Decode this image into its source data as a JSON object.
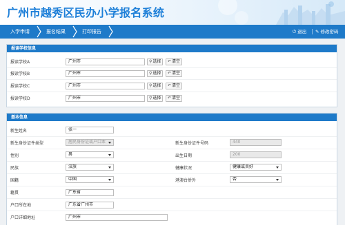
{
  "app": {
    "title": "广州市越秀区民办小学报名系统"
  },
  "nav": {
    "items": [
      {
        "label": "入学申请"
      },
      {
        "label": "报名结果"
      },
      {
        "label": "打印报告"
      }
    ],
    "logout_label": "退出",
    "change_password_label": "修改密码"
  },
  "school_section": {
    "title": "报读学校信息",
    "notice": "",
    "rows": [
      {
        "label": "报读学校A",
        "value": "广州市",
        "select_label": "选择",
        "clear_label": "清空"
      },
      {
        "label": "报读学校B",
        "value": "广州市",
        "select_label": "选择",
        "clear_label": "清空"
      },
      {
        "label": "报读学校C",
        "value": "广州市",
        "select_label": "选择",
        "clear_label": "清空"
      },
      {
        "label": "报读学校D",
        "value": "广州市",
        "select_label": "选择",
        "clear_label": "清空"
      }
    ]
  },
  "basic_section": {
    "title": "基本信息",
    "name_label": "新生姓名",
    "name_value": "张一",
    "id_type_label": "新生身份证件类型",
    "id_type_value": "居民身份证或户口本",
    "id_number_label": "新生身份证件号码",
    "id_number_value": "440",
    "gender_label": "性别",
    "gender_value": "男",
    "birth_label": "出生日期",
    "birth_value": "200",
    "ethnicity_label": "民族",
    "ethnicity_value": "汉族",
    "health_label": "健康状况",
    "health_value": "健康或良好",
    "nationality_label": "国籍",
    "nationality_value": "中国",
    "hkmt_label": "港澳台侨外",
    "hkmt_value": "否",
    "native_label": "籍贯",
    "native_value": "广东省",
    "hukou_label": "户口所在地",
    "hukou_value": "广东省广州市",
    "hukou_addr_label": "户口详细地址",
    "hukou_addr_value": "广州市"
  }
}
